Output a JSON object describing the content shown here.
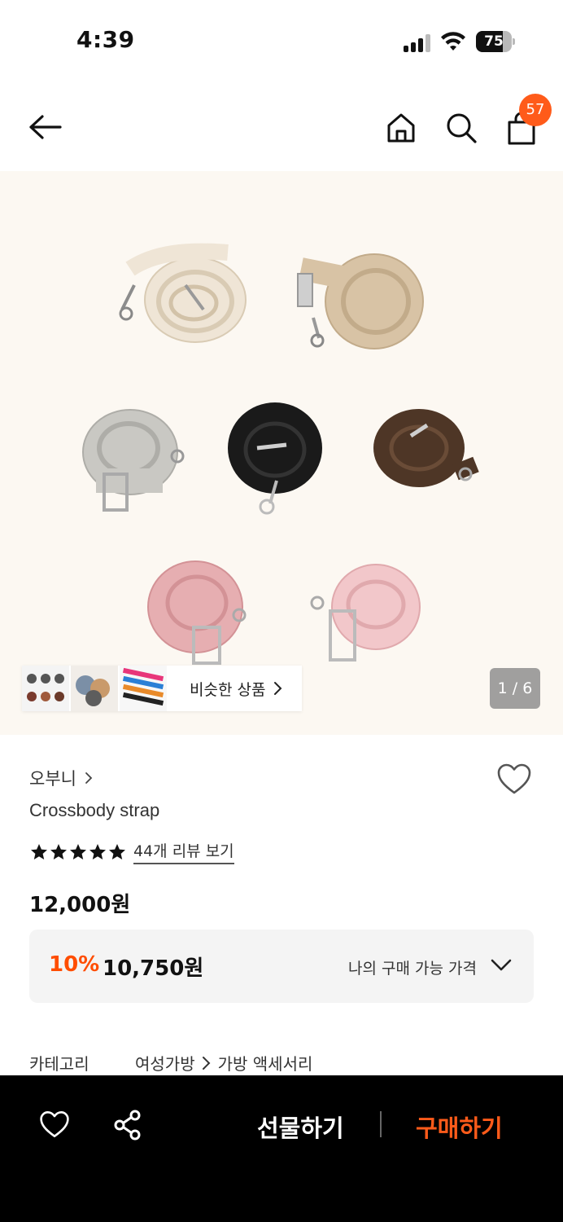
{
  "status_bar": {
    "time": "4:39",
    "battery": "75",
    "battery_level": 0.75
  },
  "nav": {
    "back_icon": "back-arrow-icon",
    "home_icon": "home-icon",
    "search_icon": "search-icon",
    "cart_icon": "shopping-bag-icon",
    "cart_count": "57"
  },
  "gallery": {
    "similar_label": "비슷한 상품",
    "pager": "1 / 6"
  },
  "product": {
    "brand": "오부니",
    "title": "Crossbody strap",
    "rating_stars": 5,
    "review_link": "44개 리뷰 보기",
    "price": "12,000원",
    "discount_rate": "10%",
    "discount_price": "10,750원",
    "my_price_label": "나의 구매 가능 가격"
  },
  "category": {
    "label": "카테고리",
    "level1": "여성가방",
    "level2": "가방 액세서리"
  },
  "bottom_bar": {
    "gift_label": "선물하기",
    "buy_label": "구매하기"
  },
  "colors": {
    "accent": "#ff5b1a",
    "discount": "#ff4d00",
    "hero_bg": "#fcf8f2"
  }
}
